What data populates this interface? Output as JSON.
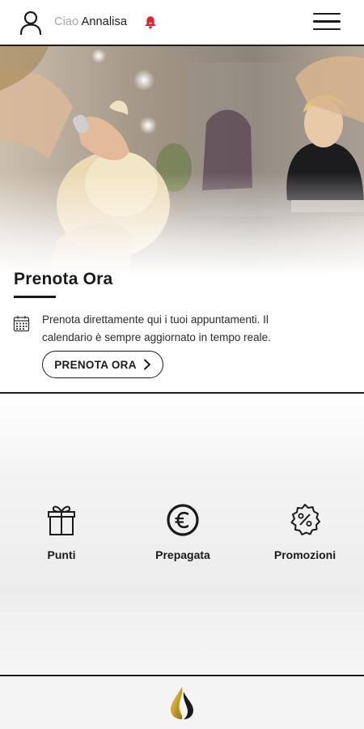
{
  "header": {
    "greeting_prefix": "Ciao",
    "user_name": "Annalisa",
    "icons": {
      "user": "user-icon",
      "notification": "bell-icon",
      "menu": "hamburger-menu-icon"
    },
    "bell_color": "#e0232f"
  },
  "hero": {
    "image": "salon-hairdresser-photo"
  },
  "booking": {
    "title": "Prenota Ora",
    "description": "Prenota direttamente qui i tuoi appuntamenti. Il calendario è sempre aggiornato in tempo reale.",
    "button_label": "PRENOTA ORA",
    "icons": {
      "calendar": "calendar-icon",
      "chevron": "chevron-right-icon"
    }
  },
  "features": [
    {
      "label": "Punti",
      "icon": "gift-icon"
    },
    {
      "label": "Prepagata",
      "icon": "euro-coin-icon"
    },
    {
      "label": "Promozioni",
      "icon": "discount-badge-icon"
    }
  ],
  "footer": {
    "logo": "gold-drop-logo-icon",
    "logo_colors": [
      "#c9a227",
      "#1a1a1a"
    ]
  }
}
